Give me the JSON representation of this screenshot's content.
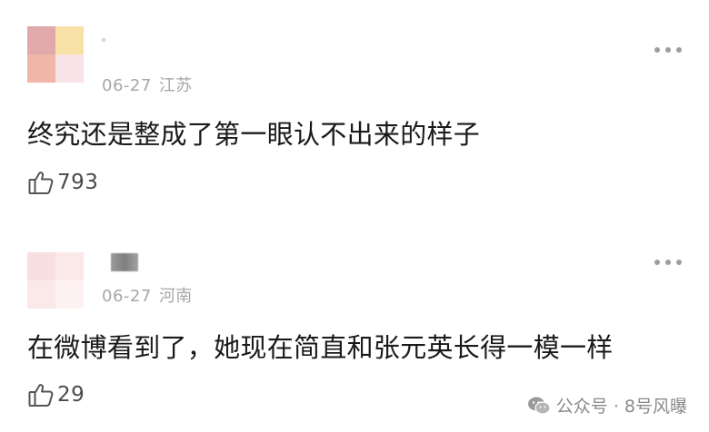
{
  "comments": [
    {
      "avatar_colors": [
        "#e2a9ad",
        "#f8e1a6",
        "#f0b6a8",
        "#f8e4e6"
      ],
      "date": "06-27",
      "region": "江苏",
      "text": "终究还是整成了第一眼认不出来的样子",
      "likes": "793",
      "icons": {
        "like": "thumbs-up-icon",
        "more": "more-dots-icon"
      }
    },
    {
      "avatar_colors": [
        "#f9dfe1",
        "#fbe9ea",
        "#fbe9ea",
        "#fdf1f1"
      ],
      "date": "06-27",
      "region": "河南",
      "text": "在微博看到了，她现在简直和张元英长得一模一样",
      "likes": "29",
      "icons": {
        "like": "thumbs-up-icon",
        "more": "more-dots-icon"
      }
    }
  ],
  "footer": {
    "icon": "wechat-icon",
    "label": "公众号 · 8号风曝"
  }
}
